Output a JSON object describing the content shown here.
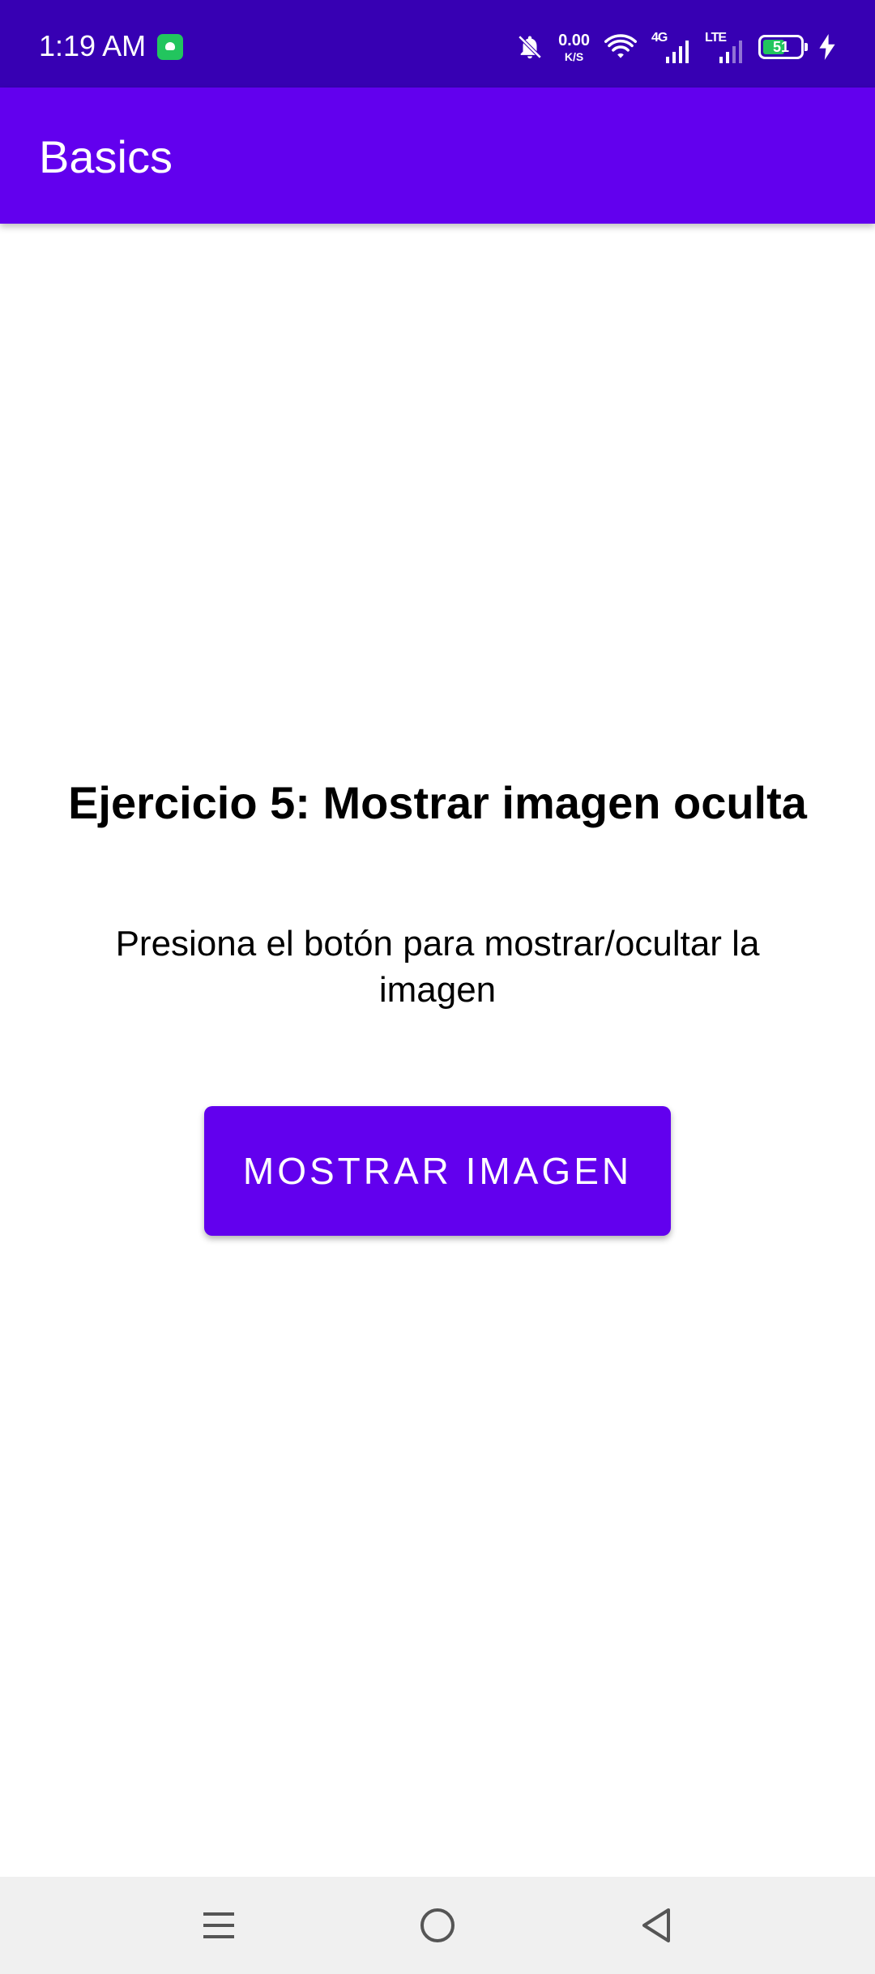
{
  "status_bar": {
    "time": "1:19 AM",
    "network_speed_value": "0.00",
    "network_speed_unit": "K/S",
    "signal_1_label": "4G",
    "signal_2_label": "LTE",
    "battery_level": "51",
    "icons": [
      "app-notification-icon",
      "bell-off-icon",
      "wifi-icon",
      "cell-signal-icon",
      "cell-signal-icon",
      "battery-icon",
      "charging-bolt-icon"
    ]
  },
  "app_bar": {
    "title": "Basics",
    "color": "#6200ee"
  },
  "content": {
    "heading": "Ejercicio 5: Mostrar imagen oculta",
    "description": "Presiona el botón para mostrar/ocultar la imagen",
    "button_label": "MOSTRAR IMAGEN"
  },
  "nav_bar": {
    "icons": [
      "menu-icon",
      "home-icon",
      "back-icon"
    ]
  },
  "colors": {
    "status_bar": "#3700b3",
    "primary": "#6200ee",
    "battery_fill": "#22c55e"
  }
}
